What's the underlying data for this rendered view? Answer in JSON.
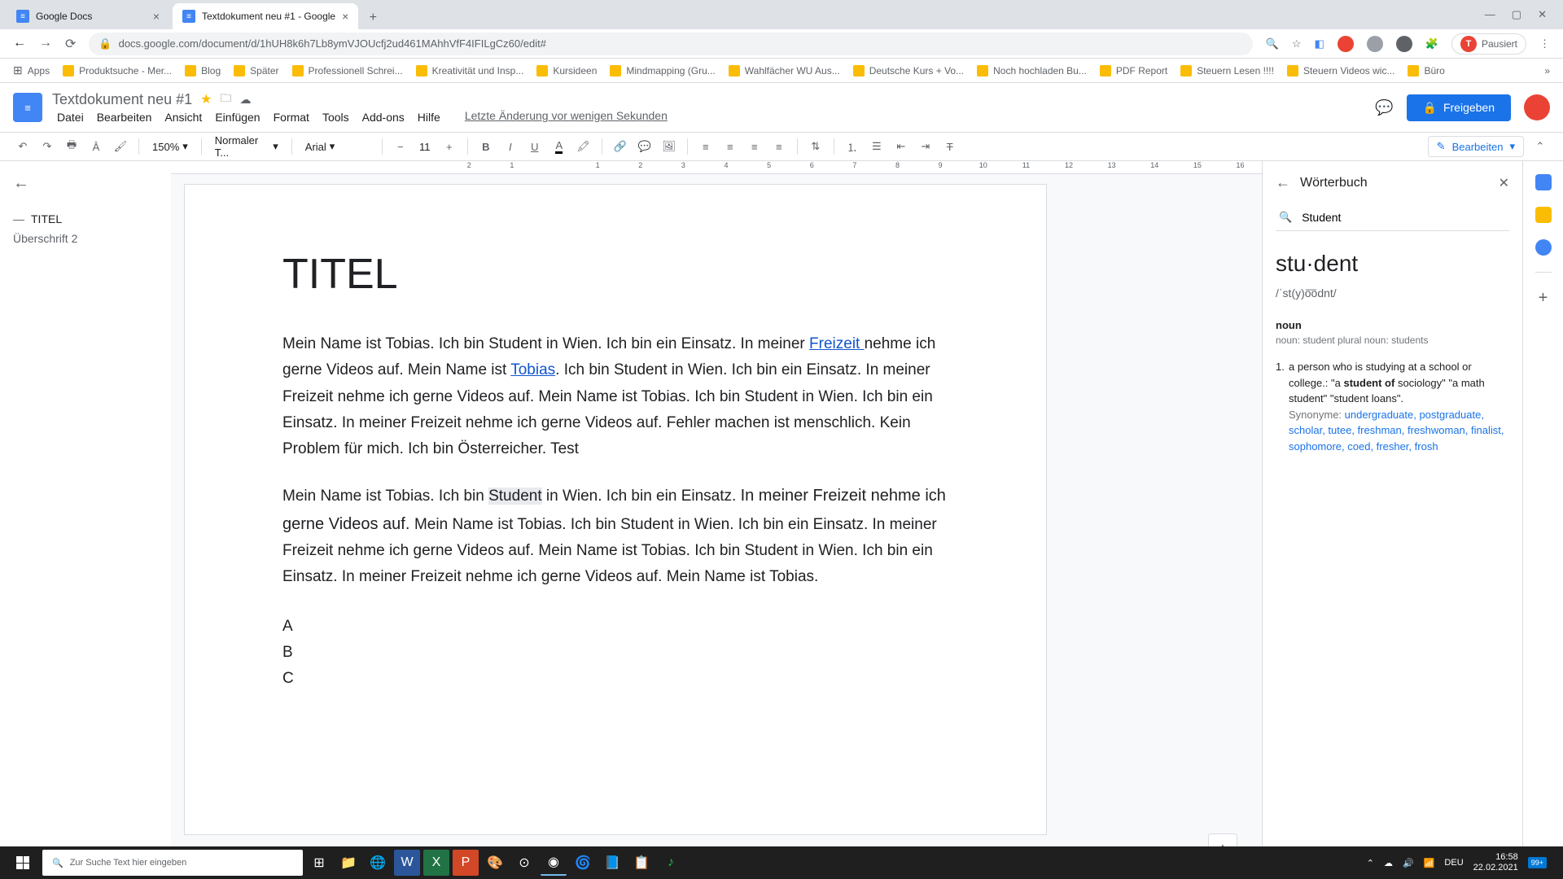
{
  "browser": {
    "tabs": [
      {
        "title": "Google Docs",
        "active": false
      },
      {
        "title": "Textdokument neu #1 - Google",
        "active": true
      }
    ],
    "url": "docs.google.com/document/d/1hUH8k6h7Lb8ymVJOUcfj2ud461MAhhVfF4IFILgCz60/edit#",
    "paused": "Pausiert"
  },
  "bookmarks": [
    "Apps",
    "Produktsuche - Mer...",
    "Blog",
    "Später",
    "Professionell Schrei...",
    "Kreativität und Insp...",
    "Kursideen",
    "Mindmapping (Gru...",
    "Wahlfächer WU Aus...",
    "Deutsche Kurs + Vo...",
    "Noch hochladen Bu...",
    "PDF Report",
    "Steuern Lesen !!!!",
    "Steuern Videos wic...",
    "Büro"
  ],
  "docs": {
    "title": "Textdokument neu #1",
    "menu": [
      "Datei",
      "Bearbeiten",
      "Ansicht",
      "Einfügen",
      "Format",
      "Tools",
      "Add-ons",
      "Hilfe"
    ],
    "last_edit": "Letzte Änderung vor wenigen Sekunden",
    "share": "Freigeben"
  },
  "toolbar": {
    "zoom": "150%",
    "style": "Normaler T...",
    "font": "Arial",
    "size": "11",
    "editing": "Bearbeiten"
  },
  "outline": {
    "items": [
      "TITEL",
      "Überschrift 2"
    ]
  },
  "document": {
    "title": "TITEL",
    "para1_a": "Mein Name ist Tobias. Ich bin Student in Wien. Ich bin ein Einsatz. In meiner ",
    "link1": "Freizeit ",
    "para1_b": "nehme ich gerne Videos auf. Mein Name ist ",
    "link2": "Tobias",
    "para1_c": ". Ich bin Student in Wien. Ich bin ein Einsatz. In meiner Freizeit nehme ich gerne Videos auf. Mein Name ist Tobias. Ich bin Student in Wien. Ich bin ein Einsatz. In meiner Freizeit nehme ich gerne Videos auf. Fehler machen ist menschlich. Kein Problem für mich. Ich bin Österreicher. Test",
    "para2_a": "Mein Name ist Tobias. Ich bin ",
    "para2_hl": "Student",
    "para2_b": " in Wien. Ich bin ein Einsatz. ",
    "para2_c": "In meiner Freizeit nehme ich gerne Videos auf. ",
    "para2_d": "Mein Name ist Tobias. Ich bin Student in Wien. Ich bin ein Einsatz. In meiner Freizeit nehme ich gerne Videos auf. Mein Name ist Tobias. Ich bin Student in Wien. Ich bin ein Einsatz. In meiner Freizeit nehme ich gerne Videos auf. Mein Name ist Tobias.",
    "list": [
      "A",
      "B",
      "C"
    ]
  },
  "ruler": [
    "2",
    "1",
    "",
    "1",
    "2",
    "3",
    "4",
    "5",
    "6",
    "7",
    "8",
    "9",
    "10",
    "11",
    "12",
    "13",
    "14",
    "15",
    "16",
    "",
    "1"
  ],
  "dictionary": {
    "title": "Wörterbuch",
    "search": "Student",
    "word": "stu·dent",
    "pronunciation": "/ˈst(y)o͞odnt/",
    "pos": "noun",
    "forms": "noun: student plural noun: students",
    "def_num": "1.",
    "definition": "a person who is studying at a school or college.: \"a ",
    "def_bold": "student of",
    "def_rest": " sociology\" \"a math student\" \"student loans\".",
    "syn_label": "Synonyme: ",
    "synonyms": "undergraduate, postgraduate, scholar, tutee, freshman, freshwoman, finalist, sophomore, coed, fresher, frosh"
  },
  "taskbar": {
    "search_placeholder": "Zur Suche Text hier eingeben",
    "lang": "DEU",
    "time": "16:58",
    "date": "22.02.2021",
    "notif": "99+"
  }
}
